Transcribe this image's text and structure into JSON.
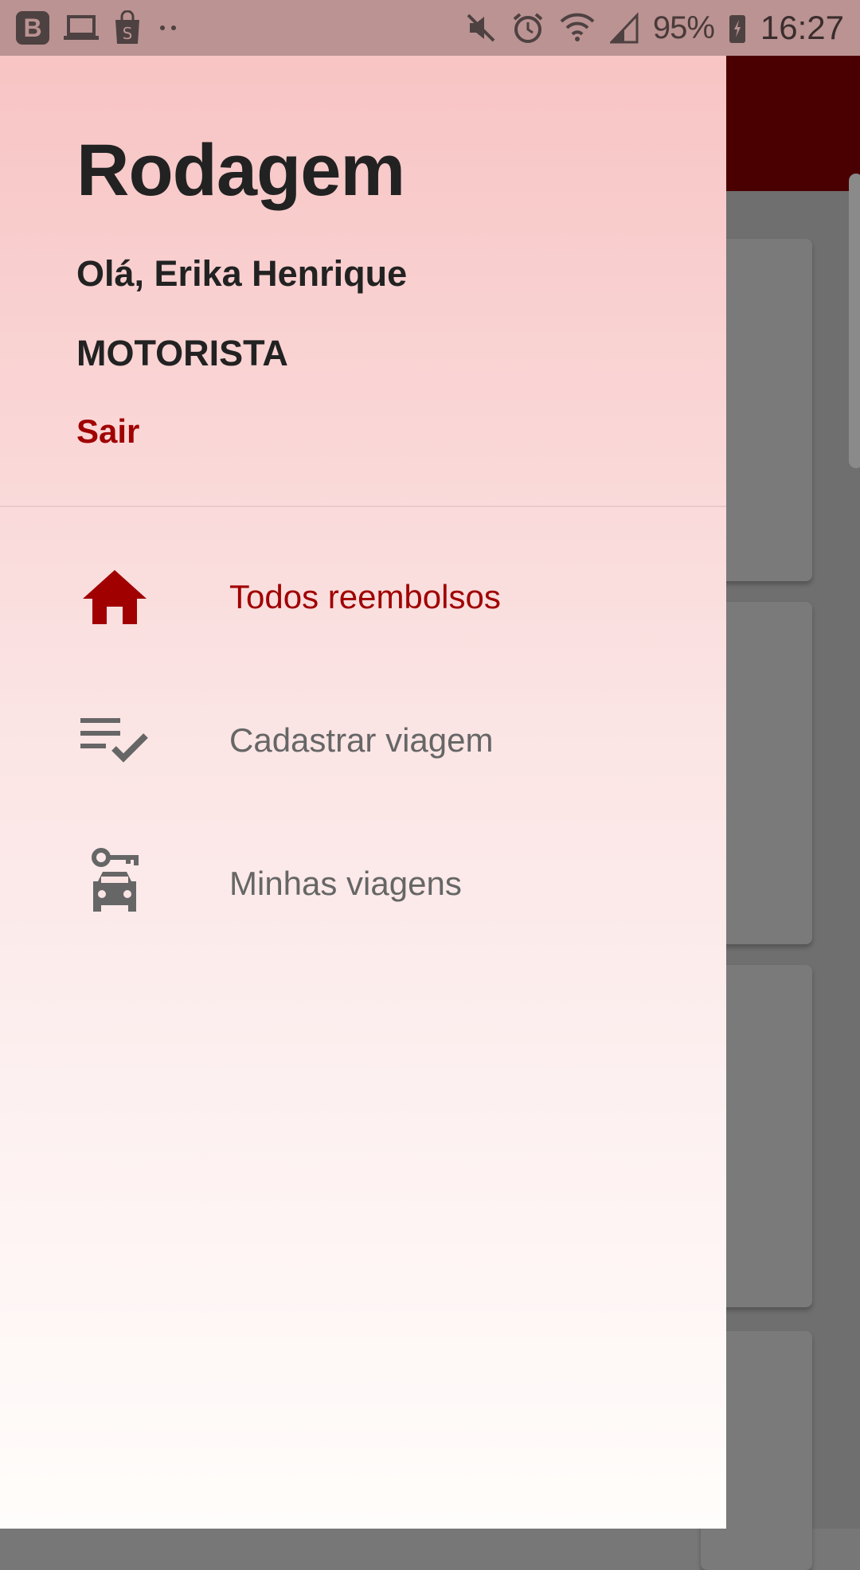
{
  "status_bar": {
    "left_icons": [
      "b-app-icon",
      "laptop-icon",
      "shopping-bag-icon",
      "more-dots-icon"
    ],
    "right_icons": [
      "mute-icon",
      "alarm-icon",
      "wifi-icon",
      "signal-icon"
    ],
    "battery": "95%",
    "time": "16:27"
  },
  "drawer": {
    "app_title": "Rodagem",
    "greeting": "Olá, Erika Henrique",
    "role": "MOTORISTA",
    "logout_label": "Sair",
    "accent_color": "#a00000",
    "items": [
      {
        "label": "Todos reembolsos",
        "icon": "home-icon",
        "active": true
      },
      {
        "label": "Cadastrar viagem",
        "icon": "playlist-check-icon",
        "active": false
      },
      {
        "label": "Minhas viagens",
        "icon": "car-key-icon",
        "active": false
      }
    ]
  }
}
